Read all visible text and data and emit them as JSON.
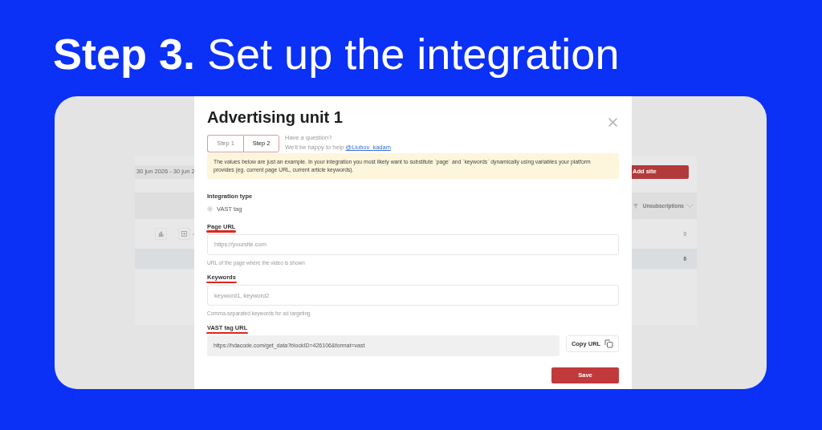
{
  "headline": "**Step 3.** Set up the integration",
  "background_app": {
    "date_range": "30 jun 2026 - 30 jun 2",
    "add_button": "Add site",
    "column_header": "Unsubscriptions",
    "rows": [
      {
        "kind": "data",
        "value": "0"
      },
      {
        "kind": "total",
        "value": "0"
      }
    ]
  },
  "modal": {
    "title": "Advertising unit 1",
    "steps": [
      {
        "label": "Step 1",
        "selected": false
      },
      {
        "label": "Step 2",
        "selected": true
      }
    ],
    "help": {
      "question": "Have a question?",
      "text": "We'll be happy to help",
      "link": "@Liubov_kadam"
    },
    "notice": "The values below are just an example. In your integration you most likely want to substitute `page` and `keywords` dynamically using variables your platform provides (eg. current page URL, current article keywords).",
    "integration_type": {
      "label": "Integration type",
      "options": [
        {
          "label": "VAST tag",
          "selected": true
        }
      ]
    },
    "fields": [
      {
        "label": "Page URL",
        "underlined": true,
        "placeholder": "https://yoursite.com",
        "hint": "URL of the page where the video is shown"
      },
      {
        "label": "Keywords",
        "underlined": true,
        "placeholder": "keyword1, keyword2",
        "hint": "Comma-separated keywords for ad targeting"
      }
    ],
    "vast": {
      "label": "VAST tag URL",
      "underlined": true,
      "value": "https://hdacode.com/get_data?blockID=426106&format=vast",
      "copy_button": "Copy URL"
    },
    "save_button": "Save"
  }
}
